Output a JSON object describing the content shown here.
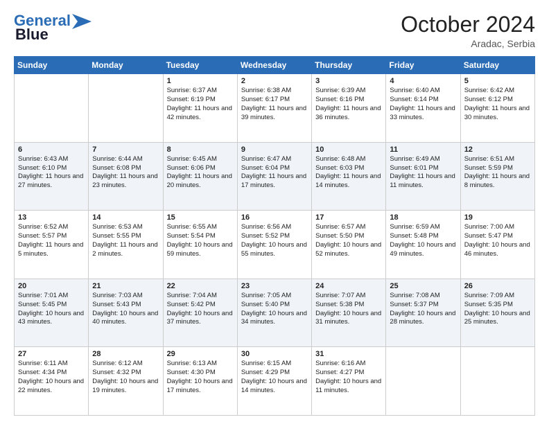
{
  "header": {
    "logo_line1": "General",
    "logo_line2": "Blue",
    "month_year": "October 2024",
    "location": "Aradac, Serbia"
  },
  "weekdays": [
    "Sunday",
    "Monday",
    "Tuesday",
    "Wednesday",
    "Thursday",
    "Friday",
    "Saturday"
  ],
  "weeks": [
    [
      {
        "day": "",
        "text": ""
      },
      {
        "day": "",
        "text": ""
      },
      {
        "day": "1",
        "text": "Sunrise: 6:37 AM\nSunset: 6:19 PM\nDaylight: 11 hours and 42 minutes."
      },
      {
        "day": "2",
        "text": "Sunrise: 6:38 AM\nSunset: 6:17 PM\nDaylight: 11 hours and 39 minutes."
      },
      {
        "day": "3",
        "text": "Sunrise: 6:39 AM\nSunset: 6:16 PM\nDaylight: 11 hours and 36 minutes."
      },
      {
        "day": "4",
        "text": "Sunrise: 6:40 AM\nSunset: 6:14 PM\nDaylight: 11 hours and 33 minutes."
      },
      {
        "day": "5",
        "text": "Sunrise: 6:42 AM\nSunset: 6:12 PM\nDaylight: 11 hours and 30 minutes."
      }
    ],
    [
      {
        "day": "6",
        "text": "Sunrise: 6:43 AM\nSunset: 6:10 PM\nDaylight: 11 hours and 27 minutes."
      },
      {
        "day": "7",
        "text": "Sunrise: 6:44 AM\nSunset: 6:08 PM\nDaylight: 11 hours and 23 minutes."
      },
      {
        "day": "8",
        "text": "Sunrise: 6:45 AM\nSunset: 6:06 PM\nDaylight: 11 hours and 20 minutes."
      },
      {
        "day": "9",
        "text": "Sunrise: 6:47 AM\nSunset: 6:04 PM\nDaylight: 11 hours and 17 minutes."
      },
      {
        "day": "10",
        "text": "Sunrise: 6:48 AM\nSunset: 6:03 PM\nDaylight: 11 hours and 14 minutes."
      },
      {
        "day": "11",
        "text": "Sunrise: 6:49 AM\nSunset: 6:01 PM\nDaylight: 11 hours and 11 minutes."
      },
      {
        "day": "12",
        "text": "Sunrise: 6:51 AM\nSunset: 5:59 PM\nDaylight: 11 hours and 8 minutes."
      }
    ],
    [
      {
        "day": "13",
        "text": "Sunrise: 6:52 AM\nSunset: 5:57 PM\nDaylight: 11 hours and 5 minutes."
      },
      {
        "day": "14",
        "text": "Sunrise: 6:53 AM\nSunset: 5:55 PM\nDaylight: 11 hours and 2 minutes."
      },
      {
        "day": "15",
        "text": "Sunrise: 6:55 AM\nSunset: 5:54 PM\nDaylight: 10 hours and 59 minutes."
      },
      {
        "day": "16",
        "text": "Sunrise: 6:56 AM\nSunset: 5:52 PM\nDaylight: 10 hours and 55 minutes."
      },
      {
        "day": "17",
        "text": "Sunrise: 6:57 AM\nSunset: 5:50 PM\nDaylight: 10 hours and 52 minutes."
      },
      {
        "day": "18",
        "text": "Sunrise: 6:59 AM\nSunset: 5:48 PM\nDaylight: 10 hours and 49 minutes."
      },
      {
        "day": "19",
        "text": "Sunrise: 7:00 AM\nSunset: 5:47 PM\nDaylight: 10 hours and 46 minutes."
      }
    ],
    [
      {
        "day": "20",
        "text": "Sunrise: 7:01 AM\nSunset: 5:45 PM\nDaylight: 10 hours and 43 minutes."
      },
      {
        "day": "21",
        "text": "Sunrise: 7:03 AM\nSunset: 5:43 PM\nDaylight: 10 hours and 40 minutes."
      },
      {
        "day": "22",
        "text": "Sunrise: 7:04 AM\nSunset: 5:42 PM\nDaylight: 10 hours and 37 minutes."
      },
      {
        "day": "23",
        "text": "Sunrise: 7:05 AM\nSunset: 5:40 PM\nDaylight: 10 hours and 34 minutes."
      },
      {
        "day": "24",
        "text": "Sunrise: 7:07 AM\nSunset: 5:38 PM\nDaylight: 10 hours and 31 minutes."
      },
      {
        "day": "25",
        "text": "Sunrise: 7:08 AM\nSunset: 5:37 PM\nDaylight: 10 hours and 28 minutes."
      },
      {
        "day": "26",
        "text": "Sunrise: 7:09 AM\nSunset: 5:35 PM\nDaylight: 10 hours and 25 minutes."
      }
    ],
    [
      {
        "day": "27",
        "text": "Sunrise: 6:11 AM\nSunset: 4:34 PM\nDaylight: 10 hours and 22 minutes."
      },
      {
        "day": "28",
        "text": "Sunrise: 6:12 AM\nSunset: 4:32 PM\nDaylight: 10 hours and 19 minutes."
      },
      {
        "day": "29",
        "text": "Sunrise: 6:13 AM\nSunset: 4:30 PM\nDaylight: 10 hours and 17 minutes."
      },
      {
        "day": "30",
        "text": "Sunrise: 6:15 AM\nSunset: 4:29 PM\nDaylight: 10 hours and 14 minutes."
      },
      {
        "day": "31",
        "text": "Sunrise: 6:16 AM\nSunset: 4:27 PM\nDaylight: 10 hours and 11 minutes."
      },
      {
        "day": "",
        "text": ""
      },
      {
        "day": "",
        "text": ""
      }
    ]
  ]
}
